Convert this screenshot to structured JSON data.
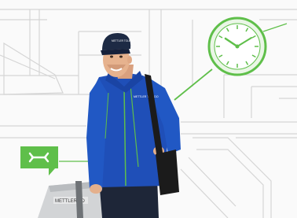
{
  "scene": {
    "badge_icon": "wrench-icon",
    "clock_icon": "clock-icon",
    "cap_text": "METTLER TOLEDO",
    "jacket_text": "METTLER TOLEDO",
    "case_text": "METTLER TO",
    "colors": {
      "background": "#fafafa",
      "sketch_lines": "#d5d5d5",
      "accent_green": "#5fbf4a",
      "jacket_blue": "#1f4fb8",
      "cap_navy": "#1d2a44",
      "pants_navy": "#1e2638",
      "bag_black": "#1b1b1b"
    }
  }
}
